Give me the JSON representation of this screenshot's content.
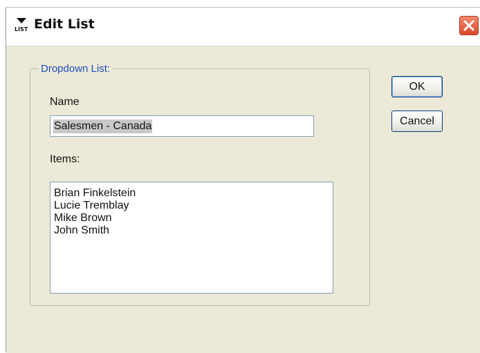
{
  "window": {
    "title": "Edit List",
    "icon": "list-icon",
    "close_icon": "close-icon"
  },
  "group": {
    "legend": "Dropdown List:"
  },
  "name_field": {
    "label": "Name",
    "value": "Salesmen - Canada"
  },
  "items_field": {
    "label": "Items:",
    "items": [
      "Brian Finkelstein",
      "Lucie Tremblay",
      "Mike Brown",
      "John Smith"
    ]
  },
  "buttons": {
    "ok": "OK",
    "cancel": "Cancel"
  },
  "colors": {
    "dialog_background": "#ece9d8",
    "legend_text": "#1b4fb8",
    "close_button": "#d9482b",
    "field_border": "#7f9db9",
    "selection_highlight": "#c8c8c8"
  }
}
